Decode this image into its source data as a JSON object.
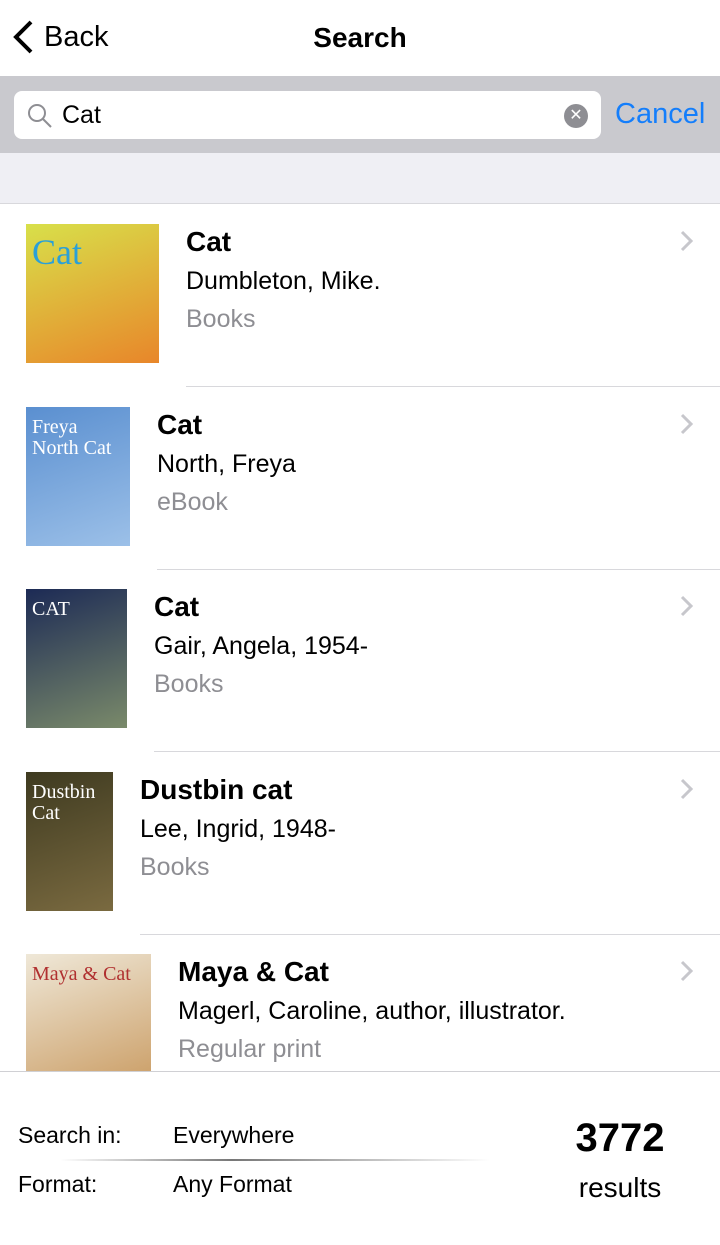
{
  "nav": {
    "back_label": "Back",
    "title": "Search"
  },
  "search": {
    "value": "Cat",
    "cancel_label": "Cancel"
  },
  "results": [
    {
      "title": "Cat",
      "author": "Dumbleton, Mike.",
      "format": "Books",
      "cover_text": "Cat",
      "cover_colors": [
        "#d8e04a",
        "#e8862a"
      ]
    },
    {
      "title": "Cat",
      "author": "North, Freya",
      "format": "eBook",
      "cover_text": "Freya North Cat",
      "cover_colors": [
        "#5a8fd0",
        "#9cc0e8"
      ]
    },
    {
      "title": "Cat",
      "author": "Gair, Angela, 1954-",
      "format": "Books",
      "cover_text": "CAT",
      "cover_colors": [
        "#1c2a55",
        "#7a8a6a"
      ]
    },
    {
      "title": "Dustbin cat",
      "author": "Lee, Ingrid, 1948-",
      "format": "Books",
      "cover_text": "Dustbin Cat",
      "cover_colors": [
        "#3e3a20",
        "#7a6a40"
      ]
    },
    {
      "title": "Maya & Cat",
      "author": "Magerl, Caroline, author, illustrator.",
      "format": "Regular print",
      "cover_text": "Maya & Cat",
      "cover_colors": [
        "#efe8d8",
        "#c99a60"
      ]
    }
  ],
  "footer": {
    "search_in_label": "Search in:",
    "search_in_value": "Everywhere",
    "format_label": "Format:",
    "format_value": "Any Format",
    "count": "3772",
    "count_label": "results"
  },
  "colors": {
    "accent": "#147efb",
    "searchbar_bg": "#c9c9ce",
    "secondary_text": "#8e8e93"
  }
}
